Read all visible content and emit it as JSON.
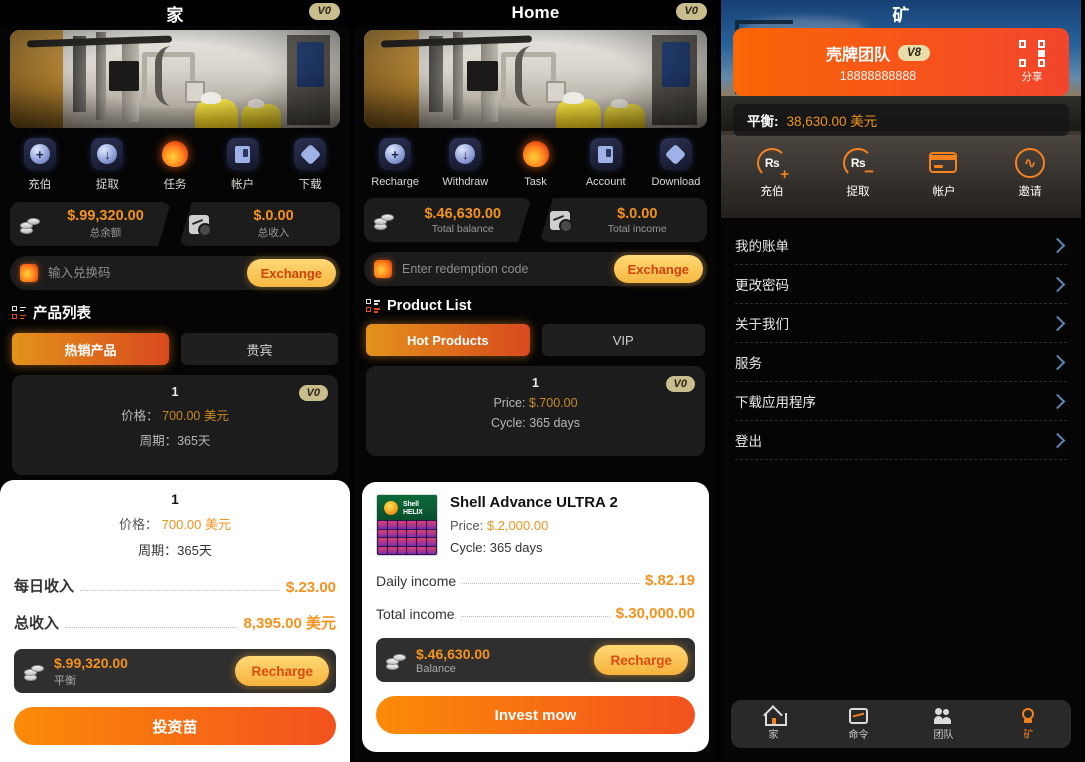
{
  "panel_zh": {
    "header": {
      "title": "家",
      "badge": "V0"
    },
    "hero": {
      "alt": "factory-photo"
    },
    "quick_actions": [
      {
        "label": "充伯",
        "icon": "plus-circle-icon"
      },
      {
        "label": "捉取",
        "icon": "arrow-down-circle-icon"
      },
      {
        "label": "任务",
        "icon": "flame-task-icon"
      },
      {
        "label": "帐户",
        "icon": "card-account-icon"
      },
      {
        "label": "下载",
        "icon": "download-diamond-icon"
      }
    ],
    "stats": [
      {
        "value": "$.99,320.00",
        "label": "总余额",
        "icon": "coins-icon"
      },
      {
        "value": "$.0.00",
        "label": "总收入",
        "icon": "chart-income-icon"
      }
    ],
    "redeem": {
      "placeholder": "输入兑换码",
      "value": "",
      "button": "Exchange",
      "icon": "gift-icon"
    },
    "product_list": {
      "title": "产品列表",
      "icon": "list-icon"
    },
    "tabs": [
      {
        "label": "热销产品",
        "active": true
      },
      {
        "label": "贵宾",
        "active": false
      }
    ],
    "behind_card": {
      "rank": "1",
      "badge": "V0",
      "price_label": "价格：",
      "price_value": "700.00 美元",
      "cycle_label": "周期：365天"
    },
    "sheet": {
      "title": "1",
      "price_label": "价格：",
      "price_value": "700.00 美元",
      "cycle_label": "周期：365天",
      "daily_label": "每日收入",
      "daily_value": "$.23.00",
      "total_label": "总收入",
      "total_value": "8,395.00 美元",
      "balance_value": "$.99,320.00",
      "balance_label": "平衡",
      "recharge_button": "Recharge",
      "cta": "投资苗"
    }
  },
  "panel_en": {
    "header": {
      "title": "Home",
      "badge": "V0"
    },
    "quick_actions": [
      {
        "label": "Recharge",
        "icon": "plus-circle-icon"
      },
      {
        "label": "Withdraw",
        "icon": "arrow-down-circle-icon"
      },
      {
        "label": "Task",
        "icon": "flame-task-icon"
      },
      {
        "label": "Account",
        "icon": "card-account-icon"
      },
      {
        "label": "Download",
        "icon": "download-cloud-icon"
      }
    ],
    "stats": [
      {
        "value": "$.46,630.00",
        "label": "Total balance",
        "icon": "coins-icon"
      },
      {
        "value": "$.0.00",
        "label": "Total income",
        "icon": "chart-income-icon"
      }
    ],
    "redeem": {
      "placeholder": "Enter redemption code",
      "value": "",
      "button": "Exchange",
      "icon": "gift-icon"
    },
    "product_list": {
      "title": "Product List",
      "icon": "list-icon"
    },
    "tabs": [
      {
        "label": "Hot Products",
        "active": true
      },
      {
        "label": "VIP",
        "active": false
      }
    ],
    "behind_card": {
      "rank": "1",
      "badge": "V0",
      "price_label": "Price:",
      "price_value": "$.700.00",
      "cycle_label": "Cycle: 365 days"
    },
    "sheet": {
      "title": "Shell Advance ULTRA 2",
      "thumb": "shell-helix-product-image",
      "price_label": "Price:",
      "price_value": "$.2,000.00",
      "cycle_label": "Cycle: 365 days",
      "daily_label": "Daily income",
      "daily_value": "$.82.19",
      "total_label": "Total income",
      "total_value": "$.30,000.00",
      "balance_value": "$.46,630.00",
      "balance_label": "Balance",
      "recharge_button": "Recharge",
      "cta": "Invest mow"
    }
  },
  "panel_mine": {
    "header": {
      "title": "矿"
    },
    "profile": {
      "name": "壳牌团队",
      "level": "V8",
      "phone": "18888888888",
      "share_label": "分享",
      "share_icon": "qr-code-icon"
    },
    "balance": {
      "label": "平衡:",
      "value": "38,630.00 美元"
    },
    "actions": [
      {
        "label": "充伯",
        "icon": "rs-plus-icon"
      },
      {
        "label": "捉取",
        "icon": "rs-minus-icon"
      },
      {
        "label": "帐户",
        "icon": "credit-card-icon"
      },
      {
        "label": "邀请",
        "icon": "invite-arrow-icon"
      }
    ],
    "menu": [
      {
        "label": "我的账单"
      },
      {
        "label": "更改密码"
      },
      {
        "label": "关于我们"
      },
      {
        "label": "服务"
      },
      {
        "label": "下载应用程序"
      },
      {
        "label": "登出"
      }
    ],
    "nav": [
      {
        "label": "家",
        "icon": "home-icon",
        "active": false
      },
      {
        "label": "命令",
        "icon": "monitor-chart-icon",
        "active": false
      },
      {
        "label": "团队",
        "icon": "team-icon",
        "active": false
      },
      {
        "label": "矿",
        "icon": "person-icon",
        "active": true
      }
    ]
  },
  "colors": {
    "accent_orange": "#f5921e",
    "cta_gradient_start": "#fb8b08",
    "cta_gradient_end": "#f3521e",
    "badge_gold": "#c9bd8e",
    "sheet_bg": "#ffffff",
    "panel_bg": "#050505"
  }
}
